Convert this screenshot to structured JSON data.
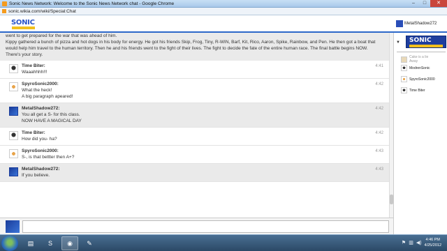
{
  "window": {
    "title": "Sonic News Network: Welcome to the Sonic News Network chat - Google Chrome",
    "url": "sonic.wikia.com/wiki/Special:Chat"
  },
  "header": {
    "logo_text": "SONIC",
    "current_user": "MetalShadow272"
  },
  "story": {
    "line1": "went to get prepared for the war that was ahead of him.",
    "line2": "Kippy gathered a bunch of pizza and hot dogs in his body for energy. He got his friends Skip, Frog, Tiny, R-WIN, Barf, Kit, Rico, Aaron, Spike, Rainbow, and Pen. He then got a boat that",
    "line3": "would help him travel to the human territory. Then he and his friends went to the fight of their lives. The fight to decide the fate of the entire human race. The final battle begins NOW.",
    "line4": "There's your story."
  },
  "messages": [
    {
      "user": "Time Biter:",
      "time": "4:41",
      "lines": [
        "Waaahhhh!!!"
      ]
    },
    {
      "user": "SpyroSonic2000:",
      "time": "4:42",
      "lines": [
        "What the heck!",
        "A big paragraph apeared!"
      ]
    },
    {
      "user": "MetalShadow272:",
      "time": "4:42",
      "lines": [
        "You all get a S- for this class.",
        "NOW HAVE A MAGICAL DAY"
      ]
    },
    {
      "user": "Time Biter:",
      "time": "4:42",
      "lines": [
        "How did you- ha?"
      ]
    },
    {
      "user": "SpyroSonic2000:",
      "time": "4:43",
      "lines": [
        "S-, is that bettter then A+?"
      ]
    },
    {
      "user": "MetalShadow272:",
      "time": "4:43",
      "lines": [
        "If you believe."
      ]
    }
  ],
  "input": {
    "value": "",
    "placeholder": ""
  },
  "sidebar": {
    "banner_text": "SONIC",
    "users": [
      {
        "name": "Cake is a lie",
        "status": "Away",
        "away": true
      },
      {
        "name": "ModrenSonic",
        "status": "",
        "away": false
      },
      {
        "name": "SpyroSonic2000",
        "status": "",
        "away": false
      },
      {
        "name": "Time Biter",
        "status": "",
        "away": false
      }
    ]
  },
  "taskbar": {
    "time": "4:46 PM",
    "date": "4/25/2012"
  },
  "colors": {
    "accent": "#2c68c9",
    "taskbar": "#2b4966",
    "alt_row": "#eaeaea"
  }
}
